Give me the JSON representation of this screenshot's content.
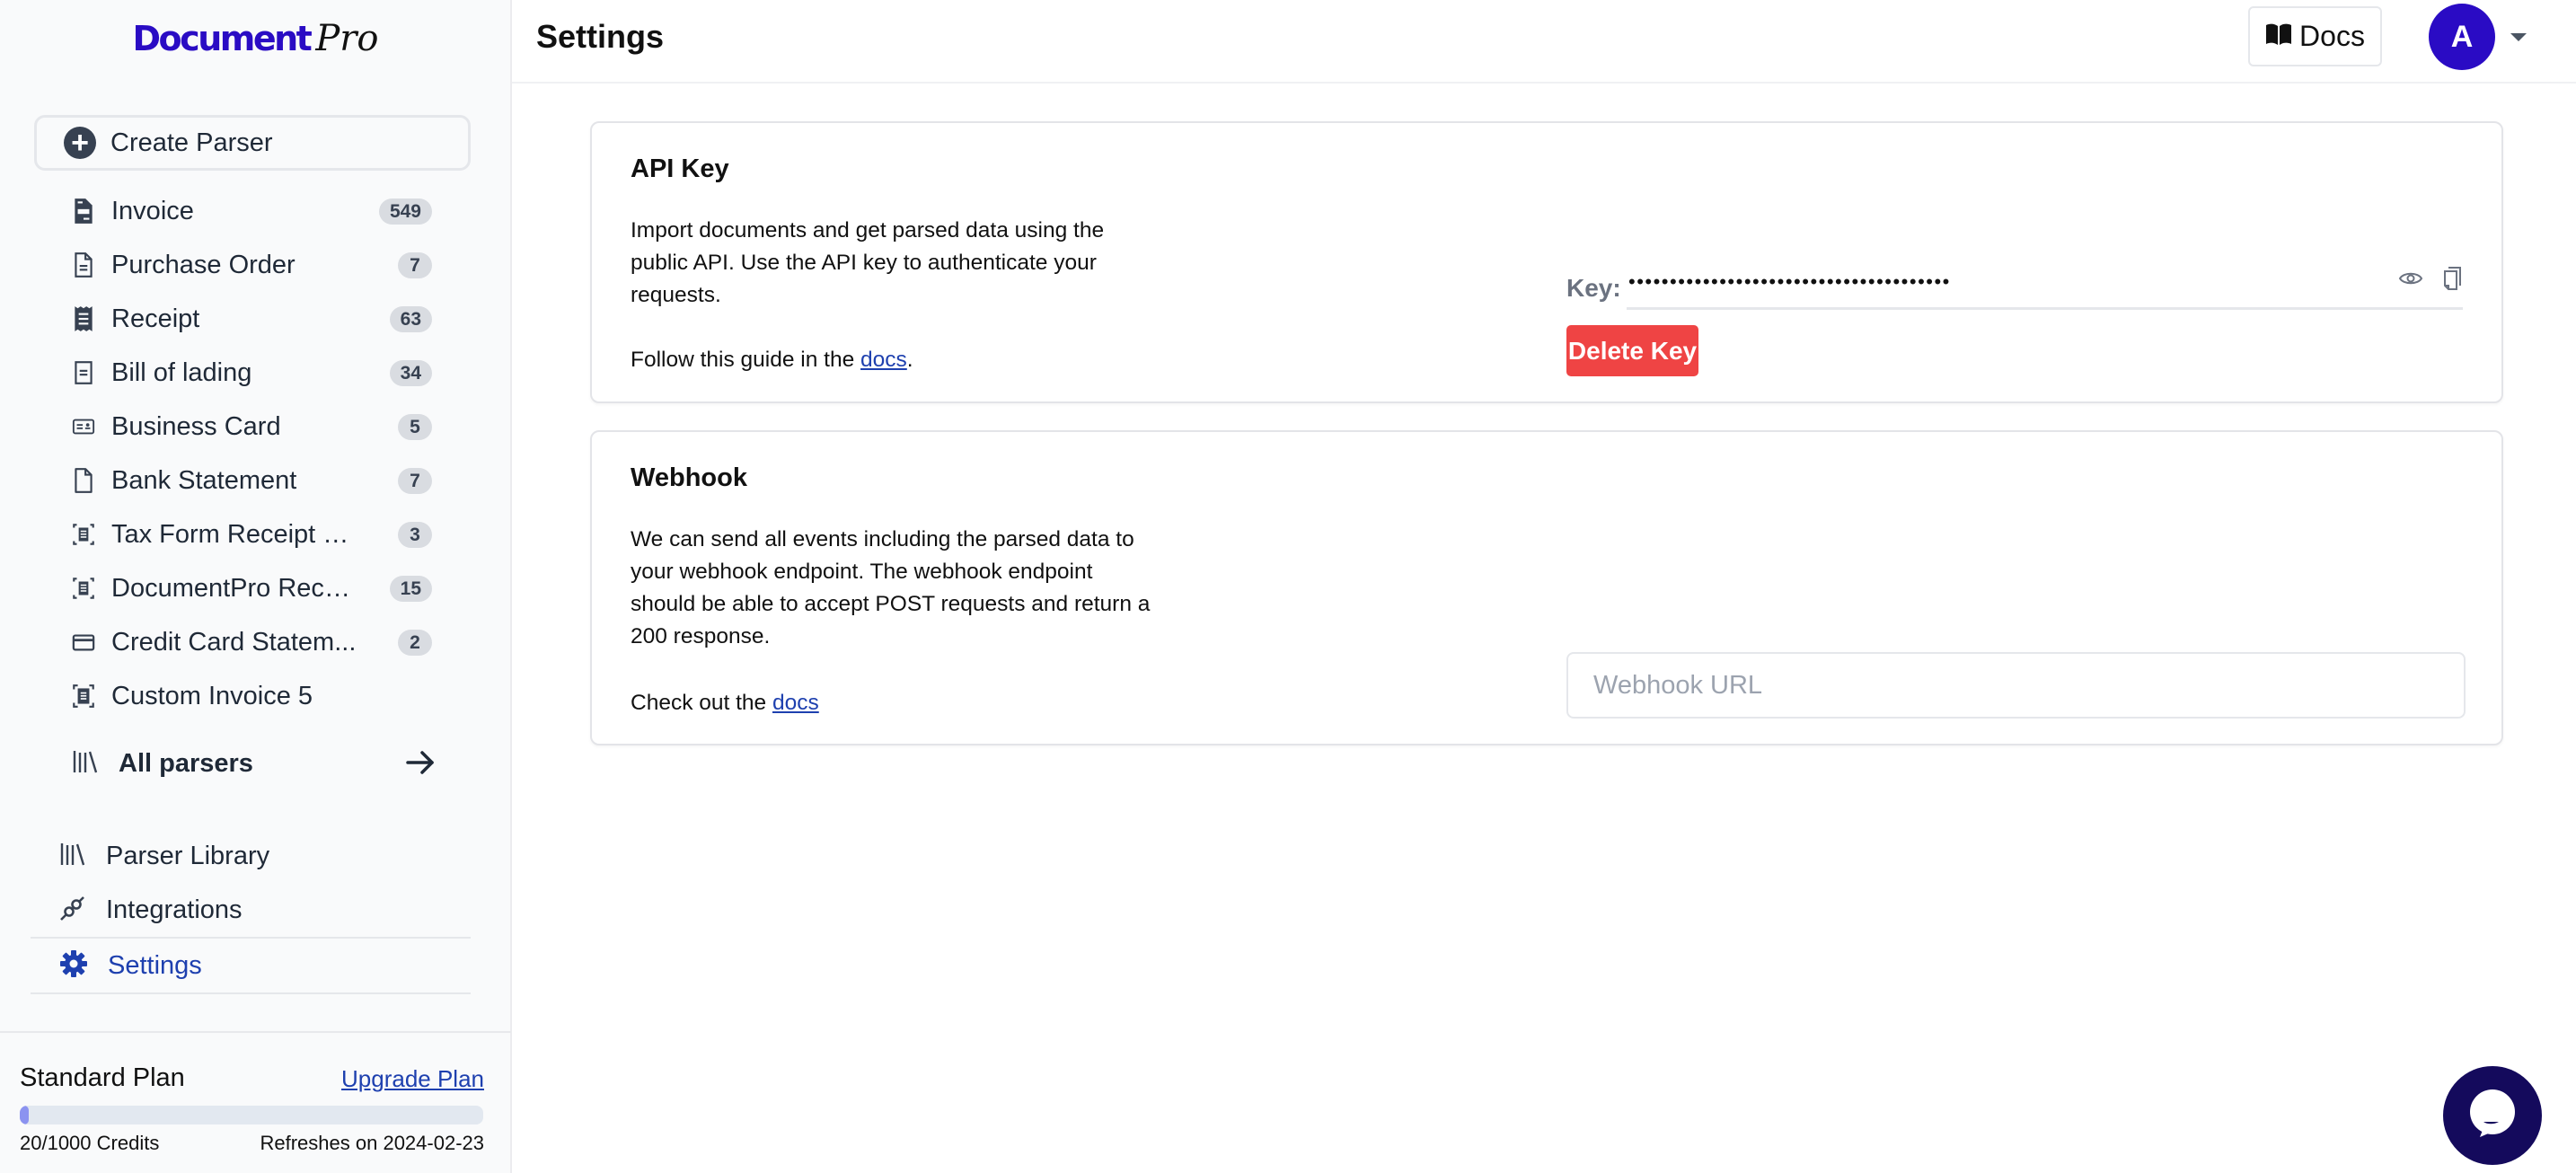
{
  "brand": {
    "name_main": "Document",
    "name_script": "Pro",
    "color": "#2a0cc4"
  },
  "sidebar": {
    "create_button": {
      "label": "Create Parser",
      "icon": "plus-circle-icon"
    },
    "parsers": [
      {
        "label": "Invoice",
        "count": "549",
        "icon": "invoice-icon"
      },
      {
        "label": "Purchase Order",
        "count": "7",
        "icon": "document-outline-icon"
      },
      {
        "label": "Receipt",
        "count": "63",
        "icon": "receipt-icon"
      },
      {
        "label": "Bill of lading",
        "count": "34",
        "icon": "document-lines-icon"
      },
      {
        "label": "Business Card",
        "count": "5",
        "icon": "id-card-icon"
      },
      {
        "label": "Bank Statement",
        "count": "7",
        "icon": "blank-document-icon"
      },
      {
        "label": "Tax Form Receipt C...",
        "count": "3",
        "icon": "scan-document-icon"
      },
      {
        "label": "DocumentPro Recei...",
        "count": "15",
        "icon": "scan-document-icon"
      },
      {
        "label": "Credit Card Statem...",
        "count": "2",
        "icon": "credit-card-icon"
      },
      {
        "label": "Custom Invoice 5",
        "count": null,
        "icon": "scan-document-icon"
      }
    ],
    "all_parsers": {
      "label": "All parsers",
      "icon": "library-icon",
      "arrow": "arrow-right-icon"
    },
    "nav": [
      {
        "label": "Parser Library",
        "icon": "library-icon",
        "active": false
      },
      {
        "label": "Integrations",
        "icon": "plug-icon",
        "active": false
      },
      {
        "label": "Settings",
        "icon": "gear-icon",
        "active": true
      }
    ],
    "plan": {
      "name": "Standard Plan",
      "upgrade_label": "Upgrade Plan",
      "credits_used": 20,
      "credits_total": 1000,
      "credits_text": "20/1000 Credits",
      "refresh_text": "Refreshes on 2024-02-23"
    }
  },
  "header": {
    "title": "Settings",
    "docs_label": "Docs",
    "avatar_initial": "A",
    "avatar_color": "#2a0bc4"
  },
  "api_key": {
    "title": "API Key",
    "description": "Import documents and get parsed data using the public API. Use the API key to authenticate your requests.",
    "guide_prefix": "Follow this guide in the ",
    "guide_link": "docs",
    "guide_suffix": ".",
    "key_label": "Key:",
    "key_masked": "•••••••••••••••••••••••••••••••••••••••",
    "delete_label": "Delete Key",
    "delete_color": "#ef4444"
  },
  "webhook": {
    "title": "Webhook",
    "description": "We can send all events including the parsed data to your webhook endpoint. The webhook endpoint should be able to accept POST requests and return a 200 response.",
    "check_prefix": "Check out the ",
    "check_link": "docs",
    "url_value": "",
    "url_placeholder": "Webhook URL"
  },
  "chat_widget": {
    "icon": "chat-bubble-icon",
    "color": "#140a5c"
  }
}
